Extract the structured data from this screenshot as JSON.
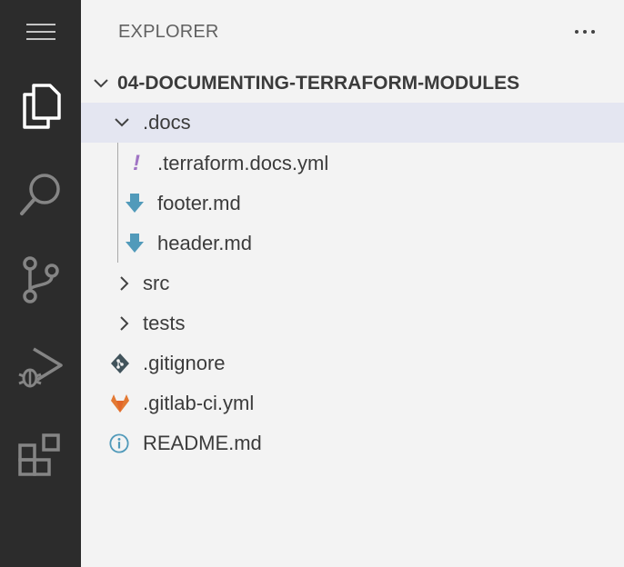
{
  "explorer": {
    "title": "EXPLORER",
    "more_label": "...",
    "root": "04-DOCUMENTING-TERRAFORM-MODULES",
    "items": [
      {
        "label": ".docs",
        "type": "folder",
        "expanded": true,
        "selected": true
      },
      {
        "label": ".terraform.docs.yml",
        "type": "file",
        "icon": "exclamation-yaml-icon"
      },
      {
        "label": "footer.md",
        "type": "file",
        "icon": "markdown-arrow-icon"
      },
      {
        "label": "header.md",
        "type": "file",
        "icon": "markdown-arrow-icon"
      },
      {
        "label": "src",
        "type": "folder",
        "expanded": false
      },
      {
        "label": "tests",
        "type": "folder",
        "expanded": false
      },
      {
        "label": ".gitignore",
        "type": "file",
        "icon": "git-icon"
      },
      {
        "label": ".gitlab-ci.yml",
        "type": "file",
        "icon": "gitlab-icon"
      },
      {
        "label": "README.md",
        "type": "file",
        "icon": "info-icon"
      }
    ]
  },
  "activity_bar": {
    "icons": [
      "menu-icon",
      "files-icon",
      "search-icon",
      "source-control-icon",
      "run-debug-icon",
      "extensions-icon"
    ]
  },
  "colors": {
    "activity_bg": "#2c2c2c",
    "sidebar_bg": "#f3f3f3",
    "selected_bg": "#e4e6f1",
    "markdown_icon": "#519aba",
    "yaml_icon": "#a074c4",
    "gitlab_icon": "#e37933"
  }
}
